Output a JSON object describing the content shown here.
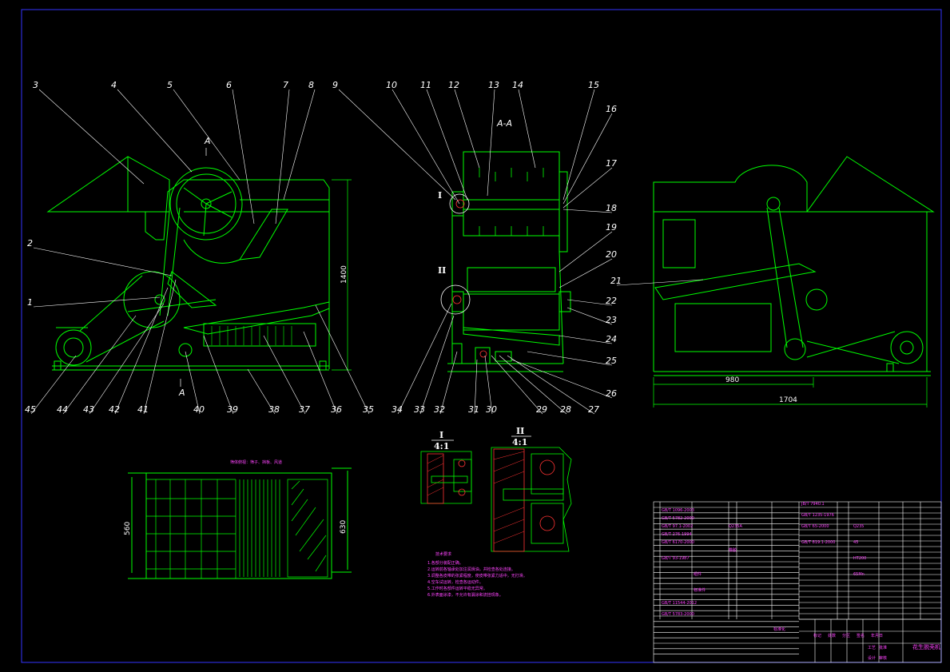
{
  "drawing": {
    "colors": {
      "background": "#000000",
      "outline": "#00ff00",
      "leader": "#ffffff",
      "border": "#3333ff",
      "hatch": "#ff3333",
      "annotation": "#ff44ff",
      "center": "#ff4444"
    },
    "section_label": "A-A",
    "section_marks": [
      "A",
      "A"
    ],
    "detail_marks": [
      "I",
      "II"
    ],
    "details": [
      {
        "mark": "I",
        "scale": "4:1"
      },
      {
        "mark": "II",
        "scale": "4:1"
      }
    ],
    "dimensions": {
      "height": "1400",
      "inner_width": "980",
      "overall_width": "1704",
      "plan_length": "560",
      "plan_width": "630"
    },
    "part_numbers": [
      "1",
      "2",
      "3",
      "4",
      "5",
      "6",
      "7",
      "8",
      "9",
      "10",
      "11",
      "12",
      "13",
      "14",
      "15",
      "16",
      "17",
      "18",
      "19",
      "20",
      "21",
      "22",
      "23",
      "24",
      "25",
      "26",
      "27",
      "28",
      "29",
      "30",
      "31",
      "32",
      "33",
      "34",
      "35",
      "36",
      "37",
      "38",
      "39",
      "40",
      "41",
      "42",
      "43",
      "44",
      "45"
    ],
    "plan_caption": "筛体俯视：筛子、挡板、风道",
    "notes": {
      "title": "技术要求",
      "items": [
        "1.各部分装配正确。",
        "2.运转前各轴承处加注润滑油，并检查各处连接。",
        "3.调整各皮带的张紧程度，使皮带张紧力适中，无打滑。",
        "4.空车试运转，检查各运动件。",
        "5.工作时各部件运转平稳无异常。",
        "6.外表面涂漆，不允许有漏涂和流挂现象。"
      ]
    },
    "title_block": {
      "drawing_name": "花生脱壳机",
      "labels": [
        "标记",
        "处数",
        "分区",
        "签名",
        "年月日",
        "设计",
        "审核",
        "工艺",
        "批准",
        "标准化"
      ]
    },
    "bom_left": [
      "GB/T 1096-2003",
      "GB/T 5782-2000",
      "GB/T 97.1-2002",
      "GB/T 276-1994",
      "GB/T 6170-2000",
      "GB/T 93-1987",
      "GB/T 11544-2012",
      "GB/T 5783-2000",
      "JB/T 7940.1",
      "GB/T 1235-1976",
      "GB/T 65-2000",
      "GB/T 819.1-2000"
    ],
    "bom_right": [
      "Q235",
      "45",
      "HT200",
      "65Mn",
      "Q235A",
      "橡胶",
      "组件",
      "标准件"
    ]
  }
}
